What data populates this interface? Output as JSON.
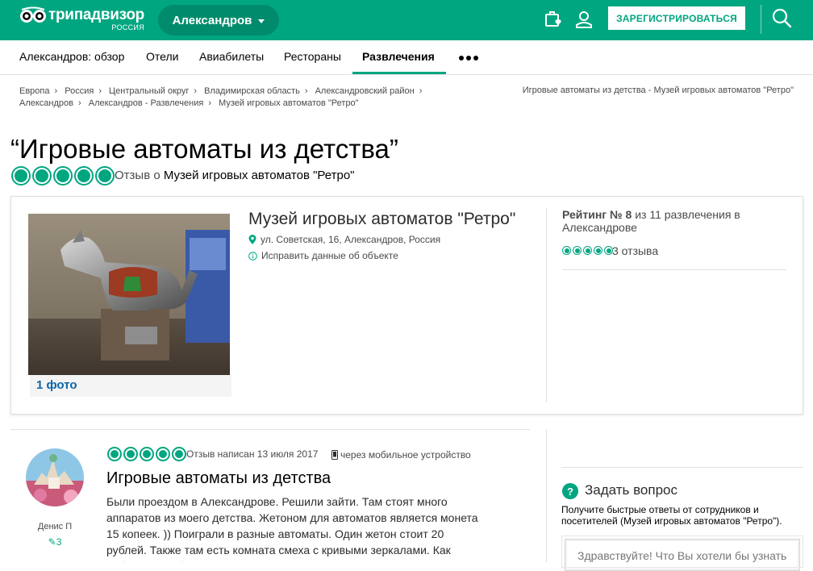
{
  "header": {
    "logo_main": "трипадвизор",
    "logo_sub": "РОССИЯ",
    "geo_label": "Александров",
    "register_label": "ЗАРЕГИСТРИРОВАТЬСЯ",
    "colors": {
      "brand": "#00a680",
      "geo_pill": "#008c6c"
    }
  },
  "nav": {
    "items": [
      {
        "label": "Александров: обзор"
      },
      {
        "label": "Отели"
      },
      {
        "label": "Авиабилеты"
      },
      {
        "label": "Рестораны"
      },
      {
        "label": "Развлечения",
        "active": true
      }
    ],
    "more_icon": "more-dots-icon"
  },
  "breadcrumbs": {
    "items": [
      "Европа",
      "Россия",
      "Центральный округ",
      "Владимирская область",
      "Александровский район",
      "Александров",
      "Александров - Развлечения",
      "Музей игровых автоматов \"Ретро\""
    ],
    "right": "Игровые автоматы из детства - Музей игровых автоматов \"Ретро\""
  },
  "review_header": {
    "title": "“Игровые автоматы из детства”",
    "rating": 5,
    "review_of_prefix": "Отзыв о",
    "review_of_link": "Музей игровых автоматов \"Ретро\""
  },
  "poi": {
    "photo_count": "1 фото",
    "name": "Музей игровых автоматов \"Ретро\"",
    "address": "ул. Советская, 16, Александров, Россия",
    "edit_link": "Исправить данные об объекте",
    "rank_bold": "Рейтинг № 8",
    "rank_rest": " из 11 развлечения в Александрове",
    "rating": 5,
    "reviews_count": "3 отзыва"
  },
  "review": {
    "reviewer_name": "Денис П",
    "reviewer_contributions": "3",
    "rating": 5,
    "date": "Отзыв написан 13 июля 2017",
    "device": "через мобильное устройство",
    "title": "Игровые автоматы из детства",
    "body": "Были проездом в Александрове. Решили зайти. Там стоят много аппаратов из моего детства. Жетоном для автоматов является монета 15 копеек. )) Поиграли в разные автоматы. Один жетон стоит 20 рублей. Также там есть комната смеха с кривыми зеркалами. Как ребенок)) В общем, понравилось."
  },
  "ask": {
    "title": "Задать вопрос",
    "description": "Получите быстрые ответы от сотрудников и посетителей (Музей игровых автоматов \"Ретро\").",
    "input_placeholder": "Здравствуйте! Что Вы хотели бы узнать"
  }
}
